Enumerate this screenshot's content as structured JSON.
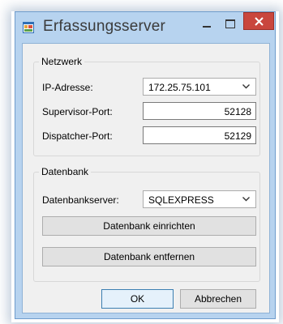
{
  "window": {
    "title": "Erfassungsserver"
  },
  "netzwerk": {
    "legend": "Netzwerk",
    "ip_label": "IP-Adresse:",
    "ip_value": "172.25.75.101",
    "supervisor_label": "Supervisor-Port:",
    "supervisor_value": "52128",
    "dispatcher_label": "Dispatcher-Port:",
    "dispatcher_value": "52129"
  },
  "datenbank": {
    "legend": "Datenbank",
    "server_label": "Datenbankserver:",
    "server_value": "SQLEXPRESS",
    "setup_button": "Datenbank einrichten",
    "remove_button": "Datenbank entfernen"
  },
  "footer": {
    "ok_button": "OK",
    "cancel_button": "Abbrechen"
  },
  "colors": {
    "frame": "#b7d3ef",
    "close": "#c9463d",
    "client": "#f0f0f0"
  },
  "icons": [
    "app-icon",
    "minimize-icon",
    "maximize-icon",
    "close-icon",
    "chevron-down-icon"
  ]
}
